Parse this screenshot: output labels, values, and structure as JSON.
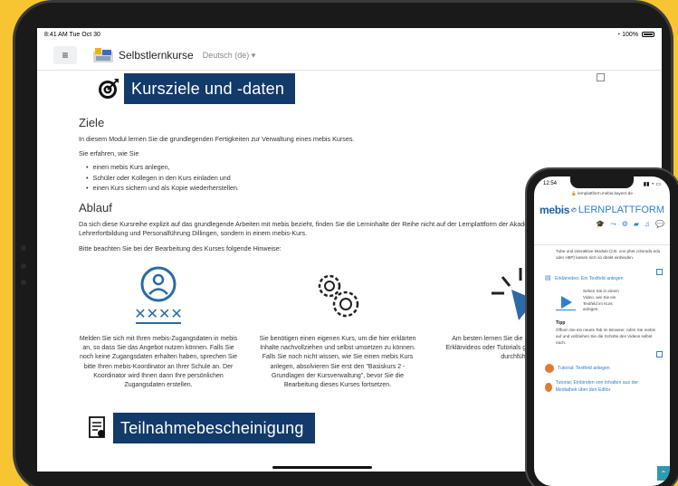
{
  "tablet": {
    "status": {
      "time": "8:41 AM  Tue Oct 30",
      "battery": "100%"
    },
    "nav": {
      "menu_icon": "hamburger-icon",
      "title": "Selbstlernkurse",
      "language": "Deutsch (de)"
    },
    "banner1": {
      "icon": "target-icon",
      "text": "Kursziele und -daten"
    },
    "ziele": {
      "heading": "Ziele",
      "intro": "In diesem Modul lernen Sie die grundlegenden Fertigkeiten zur Verwaltung eines mebis Kurses.",
      "lead": "Sie erfahren, wie Sie",
      "bullets": [
        "einen mebis Kurs anlegen,",
        "Schüler oder Kollegen in den Kurs einladen und",
        "einen Kurs sichern und als Kopie wiederherstellen."
      ]
    },
    "ablauf": {
      "heading": "Ablauf",
      "text": "Da sich diese Kursreihe explizit auf das grundlegende Arbeiten mit mebis bezieht, finden Sie die Lerninhalte der Reihe nicht auf der Lernplattform der Akademie für Lehrerfortbildung und Personalführung Dillingen, sondern in einem mebis-Kurs.",
      "hint": "Bitte beachten Sie bei der Bearbeitung des Kurses folgende Hinweise:"
    },
    "columns": [
      {
        "icon": "user-password-icon",
        "text": "Melden Sie sich mit Ihren mebis-Zugangsdaten in mebis an, so dass Sie das Angebot nutzen können. Falls Sie noch keine Zugangsdaten erhalten haben, sprechen Sie bitte Ihren mebis-Koordinator an Ihrer Schule an. Der Koordinator wird Ihnen dann Ihre persönlichen Zugangsdaten erstellen."
      },
      {
        "icon": "gears-icon",
        "text": "Sie benötigen einen eigenen Kurs, um die hier erklärten Inhalte nachvollziehen und selbst umsetzen zu können. Falls Sie noch nicht wissen, wie Sie einen mebis Kurs anlegen, absolvieren Sie erst den \"Basiskurs 2 - Grundlagen der Kursverwaltung\", bevor Sie die Bearbeitung dieses Kurses fortsetzen."
      },
      {
        "icon": "click-cursor-icon",
        "text": "Am besten lernen Sie die Inhalte, wenn Sie den Erklärvideos oder Tutorials gezeigten Schritte selbst durchführen."
      }
    ],
    "banner2": {
      "icon": "certificate-icon",
      "text": "Teilnahmebescheinigung"
    }
  },
  "phone": {
    "status": {
      "time": "12:54"
    },
    "url": "lernplattform.mebis.bayern.de",
    "logo": {
      "brand": "mebis",
      "product": "LERNPLATTFORM"
    },
    "header_icons": [
      "graduation-cap-icon",
      "share-icon",
      "gear-icon",
      "folder-icon",
      "bell-icon",
      "chat-icon"
    ],
    "intro_text": "Tube und interaktive Module (z.B. von phet.colorado.edu oder H5P) lassen sich so direkt einbinden.",
    "link1": "Erklärvideo: Ein Textfeld anlegen",
    "video_text": "Sehen Sie in einem Video, wie Sie ein Textfeld im Kurs anlegen.",
    "tipp_label": "Tipp",
    "tipp_text": "Öffnen Sie ein neues Tab im Browser, rufen Sie mebis auf und vollziehen Sie die Schritte des Videos selbst nach.",
    "tutorial1": "Tutorial: Textfeld anlegen",
    "tutorial2": "Tutorial: Einbinden von Inhalten aus der Mediathek über den Editor"
  }
}
